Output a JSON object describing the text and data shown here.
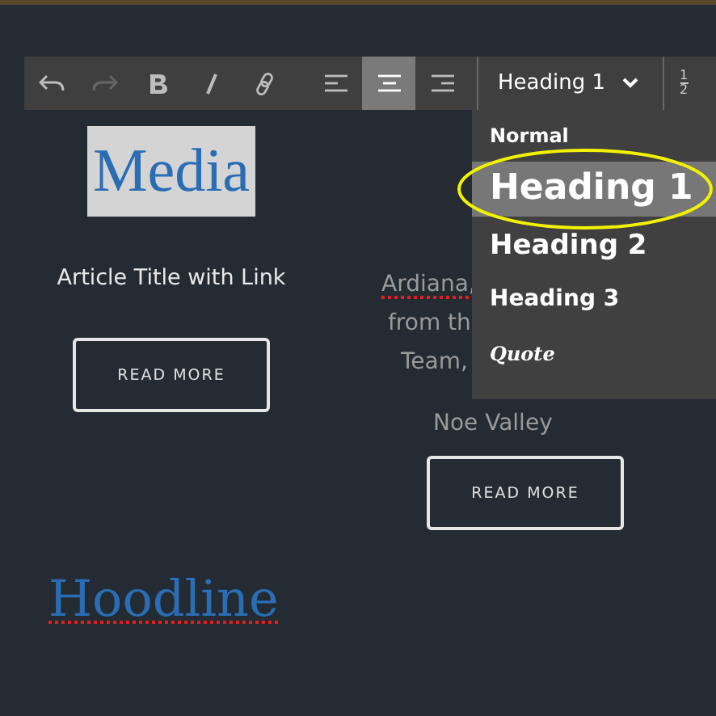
{
  "toolbar": {
    "buttons": [
      {
        "kind": "undo",
        "disabled": false,
        "selected": false
      },
      {
        "kind": "redo",
        "disabled": true,
        "selected": false
      },
      {
        "kind": "bold",
        "disabled": false,
        "selected": false
      },
      {
        "kind": "italic",
        "disabled": false,
        "selected": false
      },
      {
        "kind": "link",
        "disabled": false,
        "selected": false
      },
      {
        "kind": "align-left",
        "disabled": false,
        "selected": false
      },
      {
        "kind": "align-center",
        "disabled": false,
        "selected": true
      },
      {
        "kind": "align-right",
        "disabled": false,
        "selected": false
      }
    ],
    "style_select": {
      "value": "Heading 1",
      "expanded": true
    },
    "fraction_button": {
      "numerator": "1",
      "denominator": "2"
    }
  },
  "style_menu": {
    "items": [
      {
        "label": "Normal",
        "kind": "normal",
        "selected": false
      },
      {
        "label": "Heading 1",
        "kind": "h1",
        "selected": true
      },
      {
        "label": "Heading 2",
        "kind": "h2",
        "selected": false
      },
      {
        "label": "Heading 3",
        "kind": "h3",
        "selected": false
      },
      {
        "label": "Quote",
        "kind": "quote",
        "selected": false
      }
    ]
  },
  "columns": [
    {
      "media": "Media",
      "title": "Article Title with Link",
      "button": "READ MORE"
    },
    {
      "lines": [
        {
          "text": "Ardiana,",
          "misspelled": true
        },
        {
          "text": "from th",
          "misspelled": false
        },
        {
          "text": "Team,",
          "misspelled": false
        },
        {
          "text": "Noe Valley",
          "misspelled": false
        }
      ],
      "button": "READ MORE"
    }
  ],
  "logo": {
    "text": "Hoodline",
    "misspelled": true
  }
}
